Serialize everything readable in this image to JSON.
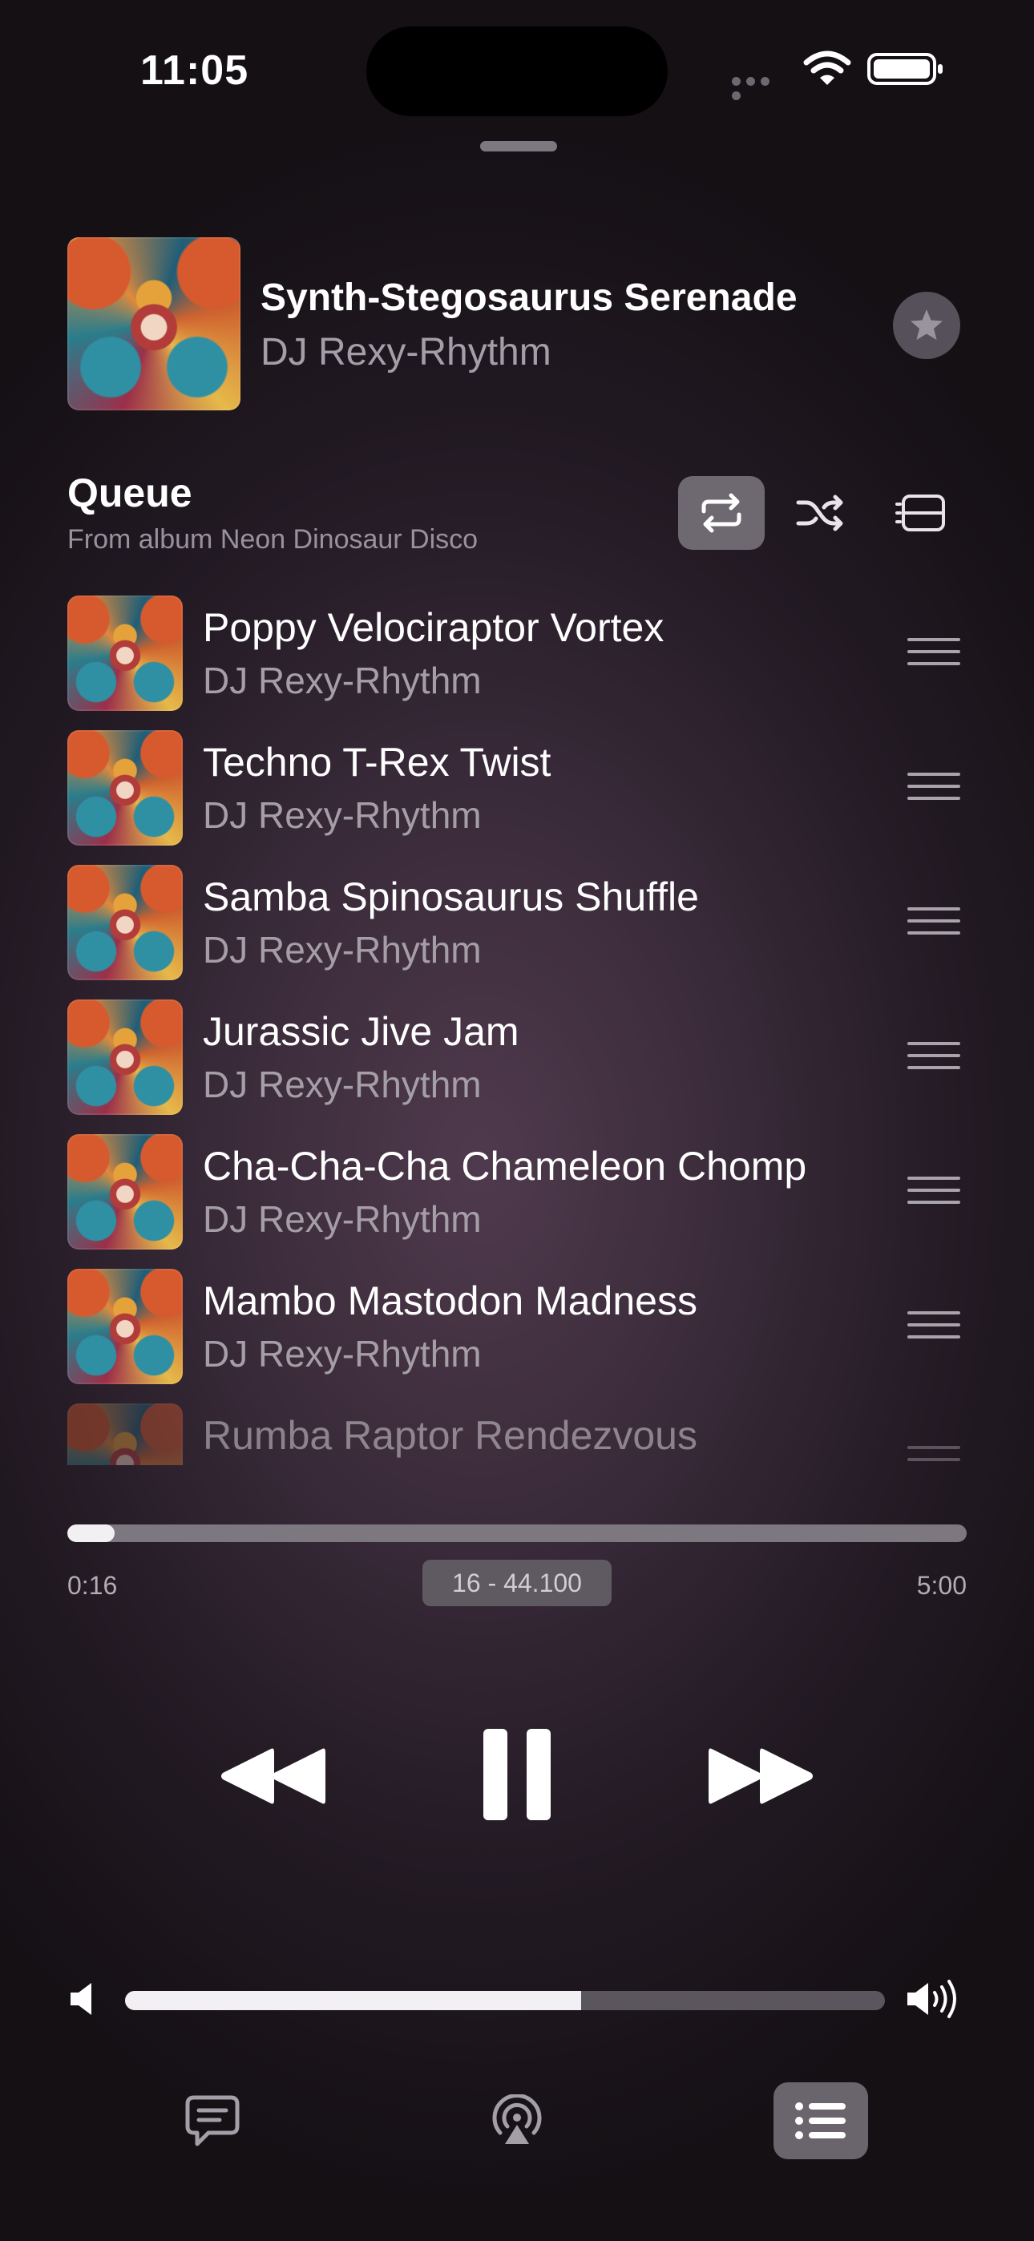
{
  "status_bar": {
    "time": "11:05"
  },
  "now_playing": {
    "title": "Synth-Stegosaurus Serenade",
    "artist": "DJ Rexy-Rhythm",
    "favorite_icon": "star-icon"
  },
  "queue": {
    "title": "Queue",
    "subtitle": "From album Neon Dinosaur Disco",
    "controls": [
      {
        "name": "repeat",
        "icon": "repeat-icon",
        "active": true
      },
      {
        "name": "shuffle",
        "icon": "shuffle-icon",
        "active": false
      },
      {
        "name": "autoplay",
        "icon": "infinity-queue-icon",
        "active": false
      }
    ],
    "items": [
      {
        "title": "Poppy Velociraptor Vortex",
        "artist": "DJ Rexy-Rhythm"
      },
      {
        "title": "Techno T-Rex Twist",
        "artist": "DJ Rexy-Rhythm"
      },
      {
        "title": "Samba Spinosaurus Shuffle",
        "artist": "DJ Rexy-Rhythm"
      },
      {
        "title": "Jurassic Jive Jam",
        "artist": "DJ Rexy-Rhythm"
      },
      {
        "title": "Cha-Cha-Cha Chameleon Chomp",
        "artist": "DJ Rexy-Rhythm"
      },
      {
        "title": "Mambo Mastodon Madness",
        "artist": "DJ Rexy-Rhythm"
      },
      {
        "title": "Rumba Raptor Rendezvous",
        "artist": ""
      }
    ]
  },
  "playback": {
    "elapsed": "0:16",
    "remaining": "5:00",
    "format": "16 - 44.100",
    "progress_fraction": 0.053
  },
  "volume": {
    "level_fraction": 0.6
  },
  "toolbar": {
    "lyrics_icon": "lyrics-bubble-icon",
    "airplay_icon": "airplay-icon",
    "queue_icon": "queue-list-icon",
    "queue_active": true
  },
  "colors": {
    "background": "#3a2b3a",
    "accent_active": "#6e6871",
    "secondary_text": "#a59ea8"
  }
}
